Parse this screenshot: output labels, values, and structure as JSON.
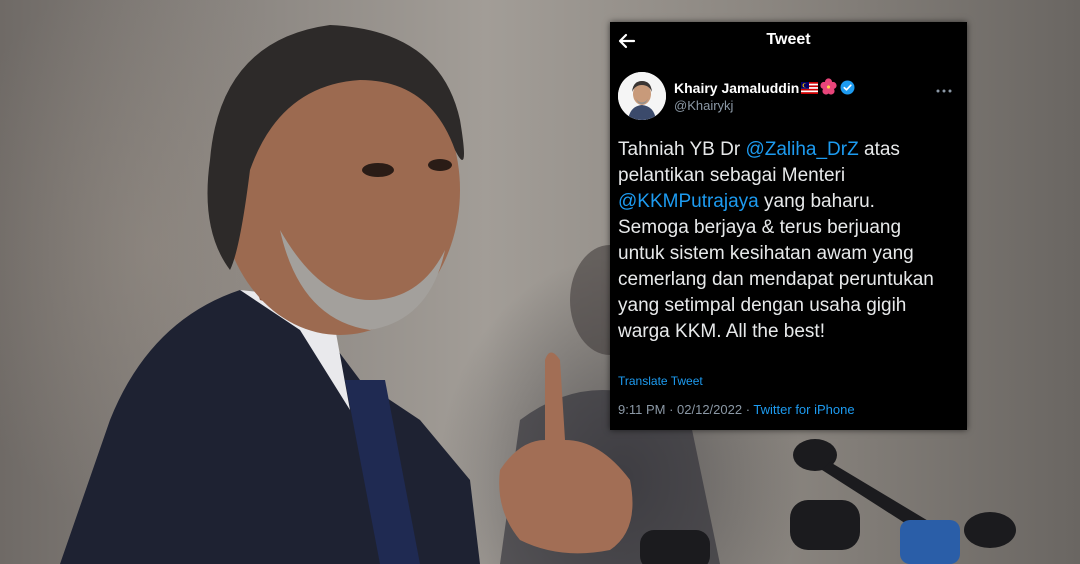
{
  "tweet": {
    "header_title": "Tweet",
    "author": {
      "name": "Khairy Jamaluddin",
      "handle": "@Khairykj"
    },
    "body": {
      "l1_a": "Tahniah YB Dr ",
      "l1_mention": "@Zaliha_DrZ",
      "l1_b": " atas",
      "l2": "pelantikan sebagai Menteri",
      "l3_mention": "@KKMPutrajaya",
      "l3_b": " yang baharu.",
      "l4": "Semoga berjaya & terus berjuang",
      "l5": "untuk sistem kesihatan awam yang",
      "l6": "cemerlang dan mendapat peruntukan",
      "l7": "yang setimpal dengan usaha gigih",
      "l8": "warga KKM. All the best!"
    },
    "translate_label": "Translate Tweet",
    "time": "9:11 PM",
    "separator": " · ",
    "date": "02/12/2022",
    "source": "Twitter for iPhone"
  },
  "colors": {
    "card_bg": "#000000",
    "text": "#e7e9ea",
    "link": "#1d9bf0",
    "secondary": "#8b98a5"
  },
  "icons": {
    "back": "arrow-left-icon",
    "flag": "malaysia-flag-icon",
    "flower": "hibiscus-icon",
    "verified": "verified-badge-icon",
    "more": "more-options-icon"
  }
}
